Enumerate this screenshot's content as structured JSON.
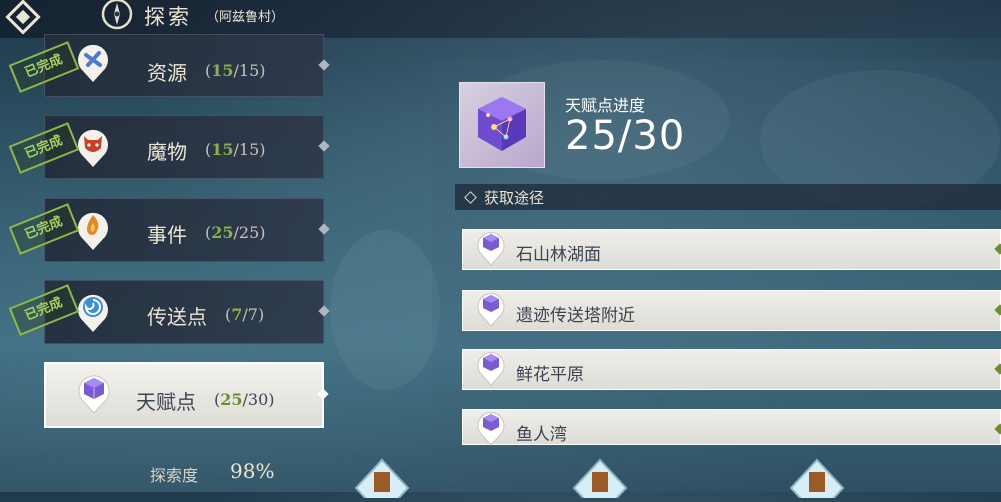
{
  "header": {
    "title": "探索",
    "subtitle": "（阿兹鲁村）"
  },
  "categories": [
    {
      "name": "资源",
      "done": "15",
      "total": "/15)",
      "open": "(",
      "stamp": "已完成",
      "icon": "resource-icon"
    },
    {
      "name": "魔物",
      "done": "15",
      "total": "/15)",
      "open": "(",
      "stamp": "已完成",
      "icon": "monster-icon"
    },
    {
      "name": "事件",
      "done": "25",
      "total": "/25)",
      "open": "(",
      "stamp": "已完成",
      "icon": "event-flame-icon"
    },
    {
      "name": "传送点",
      "done": "7",
      "total": "/7)",
      "open": "(",
      "stamp": "已完成",
      "icon": "teleport-swirl-icon"
    },
    {
      "name": "天赋点",
      "done": "25",
      "total": "/30)",
      "open": "(",
      "icon": "talent-cube-icon",
      "selected": true
    }
  ],
  "exploration": {
    "label": "探索度",
    "value": "98%"
  },
  "talent": {
    "progress_label": "天赋点进度",
    "progress_value": "25/30",
    "progress_fraction": 0.8333
  },
  "sources": {
    "header": "获取途径",
    "items": [
      {
        "name": "石山林湖面"
      },
      {
        "name": "遗迹传送塔附近"
      },
      {
        "name": "鲜花平原"
      },
      {
        "name": "鱼人湾"
      }
    ]
  },
  "colors": {
    "completed_green": "#8ab04a",
    "accent_cream": "#ece5d3",
    "cube_purple": "#7b5bd0"
  }
}
